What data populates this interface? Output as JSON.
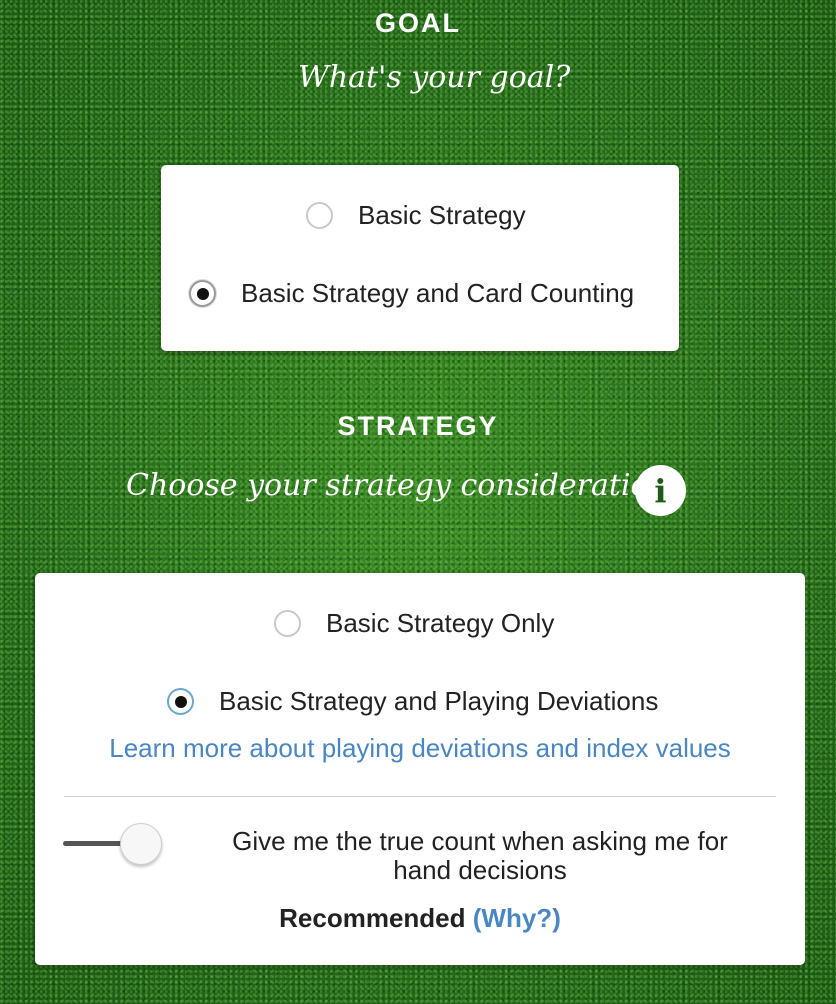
{
  "goal": {
    "title": "GOAL",
    "prompt": "What's your goal?",
    "options": [
      {
        "label": "Basic Strategy",
        "selected": false
      },
      {
        "label": "Basic Strategy and Card Counting",
        "selected": true
      }
    ]
  },
  "strategy": {
    "title": "STRATEGY",
    "prompt": "Choose your strategy considerations",
    "info_icon": "info-icon",
    "options": [
      {
        "label": "Basic Strategy Only",
        "selected": false
      },
      {
        "label": "Basic Strategy and Playing Deviations",
        "selected": true
      }
    ],
    "learn_more_link": "Learn more about playing deviations and index values",
    "toggle": {
      "label": "Give me the true count when asking me for hand decisions",
      "on": false
    },
    "recommended_label": "Recommended",
    "why_link": "(Why?)"
  },
  "colors": {
    "background": "#2e7a1f",
    "link": "#4a86c2",
    "card": "#ffffff"
  }
}
